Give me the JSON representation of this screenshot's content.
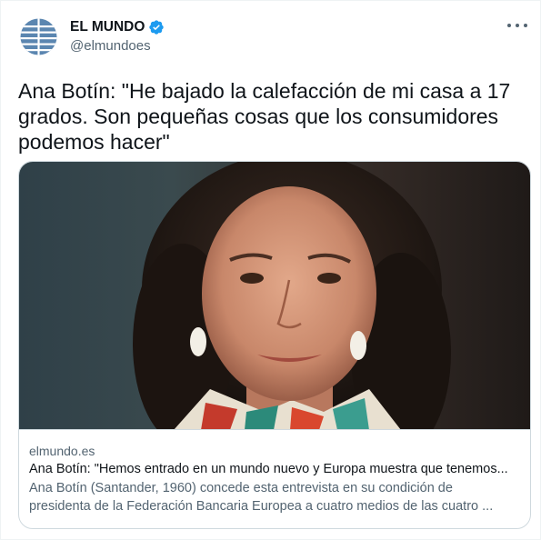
{
  "account": {
    "display_name": "EL MUNDO",
    "handle": "@elmundoes",
    "verified": true,
    "avatar_icon": "el-mundo-globe-logo",
    "brand_color": "#5b86b0"
  },
  "tweet": {
    "text": "Ana Botín: \"He bajado la calefacción de mi casa a 17 grados. Son pequeñas cosas que los consumidores podemos hacer\""
  },
  "card": {
    "image_icon": "portrait-photo",
    "domain": "elmundo.es",
    "title": "Ana Botín: \"Hemos entrado en un mundo nuevo y Europa muestra que tenemos...",
    "description_line1": "Ana Botín (Santander, 1960) concede esta entrevista en su condición de",
    "description_line2": "presidenta de la Federación Bancaria Europea a cuatro medios de las cuatro ..."
  },
  "colors": {
    "verified_blue": "#1d9bf0",
    "secondary_text": "#536471",
    "border": "#cfd9de"
  }
}
